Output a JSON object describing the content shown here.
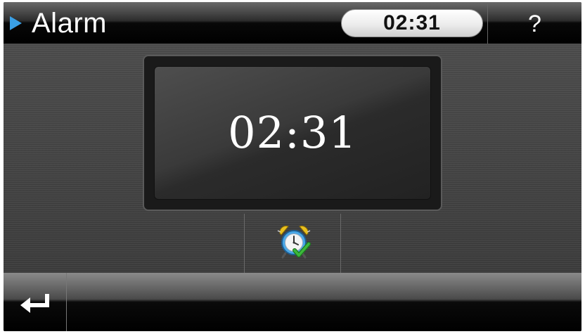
{
  "header": {
    "title": "Alarm",
    "clock": "02:31",
    "help_label": "?"
  },
  "main": {
    "alarm_time": "02:31",
    "alarm_button_icon": "alarm-clock-check-icon"
  },
  "footer": {
    "back_icon": "return-arrow-icon"
  },
  "colors": {
    "accent_arrow": "#3aa0e6",
    "checkmark": "#3cb83c",
    "bell": "#e8c020"
  }
}
